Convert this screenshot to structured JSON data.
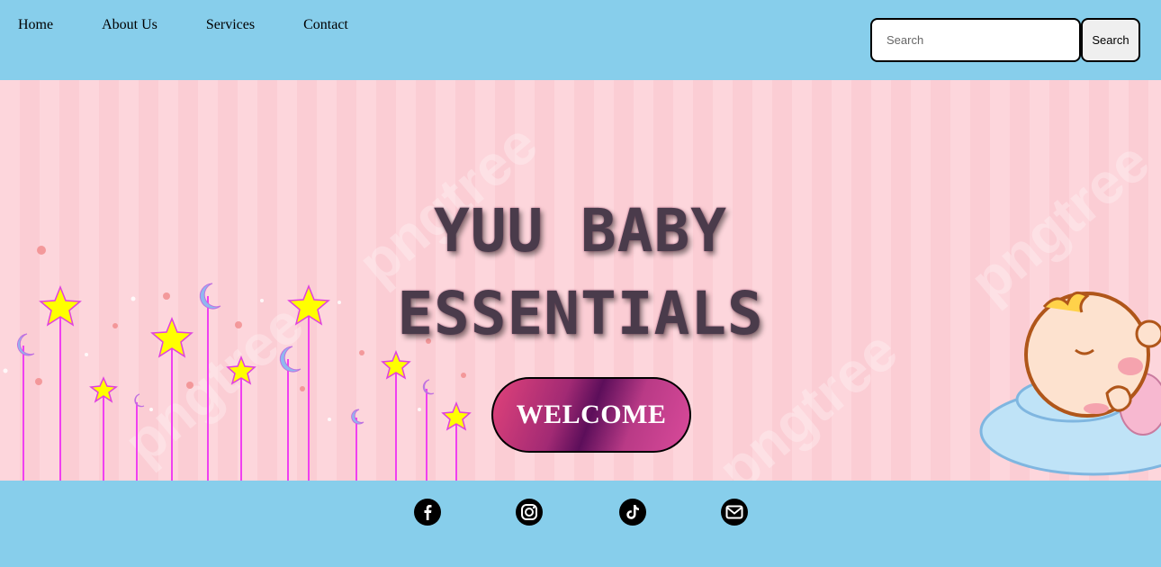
{
  "nav": {
    "items": [
      {
        "label": "Home"
      },
      {
        "label": "About Us"
      },
      {
        "label": "Services"
      },
      {
        "label": "Contact"
      }
    ]
  },
  "search": {
    "placeholder": "Search",
    "button_label": "Search"
  },
  "hero": {
    "title_line1": "YUU BABY",
    "title_line2": "ESSENTIALS",
    "welcome_label": "WELCOME",
    "watermark": "pngtree"
  },
  "footer": {
    "icons": [
      "facebook-icon",
      "instagram-icon",
      "tiktok-icon",
      "email-icon"
    ]
  },
  "colors": {
    "header_bg": "#87ceeb",
    "hero_bg": "#fdd6dc",
    "star": "#ffff00",
    "star_outline": "#e040e0",
    "moon": "#8fb8ef",
    "button_start": "#e0427a",
    "button_mid": "#5c0e5a"
  }
}
